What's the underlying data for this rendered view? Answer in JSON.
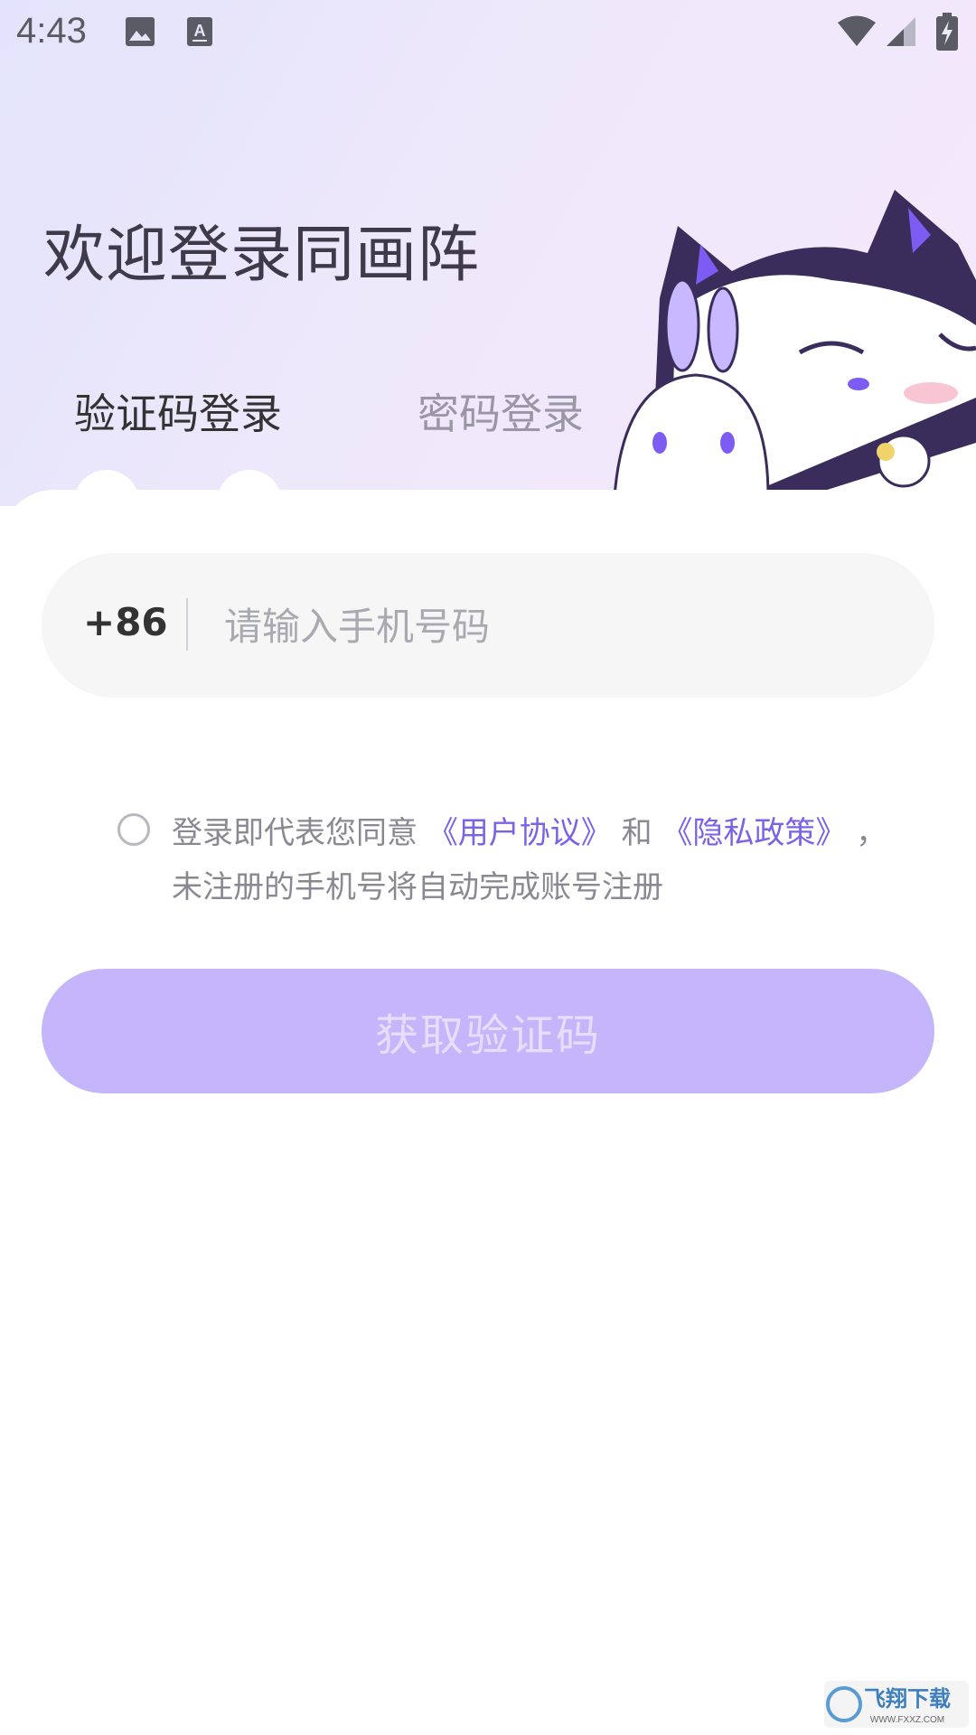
{
  "status_bar": {
    "time": "4:43",
    "icons": [
      "image-icon",
      "keyboard-a-icon",
      "wifi-icon",
      "signal-icon",
      "battery-charging-icon"
    ]
  },
  "header": {
    "title": "欢迎登录同画阵",
    "tabs": [
      {
        "label": "验证码登录",
        "active": true
      },
      {
        "label": "密码登录",
        "active": false
      }
    ]
  },
  "form": {
    "country_code": "+86",
    "phone_placeholder": "请输入手机号码",
    "phone_value": ""
  },
  "agreement": {
    "checked": false,
    "prefix": "登录即代表您同意",
    "user_agreement": "《用户协议》",
    "and": "和",
    "privacy_policy": "《隐私政策》",
    "comma": "，",
    "suffix": "未注册的手机号将自动完成账号注册"
  },
  "actions": {
    "get_code_label": "获取验证码"
  },
  "watermark": {
    "text": "飞翔下载",
    "url_text": "WWW.FXXZ.COM"
  },
  "colors": {
    "accent": "#7b62e6",
    "button_disabled": "#c5b6fb",
    "header_gradient_start": "#e3e3fb",
    "header_gradient_end": "#f6e9fb"
  }
}
